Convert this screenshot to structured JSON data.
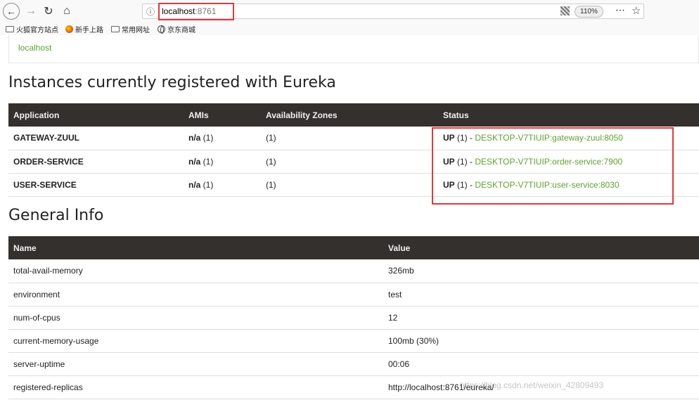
{
  "browser": {
    "url_host": "localhost",
    "url_port": ":8761",
    "zoom": "110%"
  },
  "bookmarks": [
    {
      "label": "火狐官方站点",
      "icon": "folder-icon"
    },
    {
      "label": "新手上路",
      "icon": "firefox-icon"
    },
    {
      "label": "常用网址",
      "icon": "folder-icon"
    },
    {
      "label": "京东商城",
      "icon": "globe-icon"
    }
  ],
  "page": {
    "hostname": "localhost",
    "instances_heading": "Instances currently registered with Eureka",
    "general_heading": "General Info"
  },
  "instances": {
    "headers": [
      "Application",
      "AMIs",
      "Availability Zones",
      "Status"
    ],
    "rows": [
      {
        "app": "GATEWAY-ZUUL",
        "ami_bold": "n/a",
        "ami_count": " (1)",
        "zones": "(1)",
        "status": "UP",
        "status_count": " (1) - ",
        "instance": "DESKTOP-V7TIUIP:gateway-zuul:8050"
      },
      {
        "app": "ORDER-SERVICE",
        "ami_bold": "n/a",
        "ami_count": " (1)",
        "zones": "(1)",
        "status": "UP",
        "status_count": " (1) - ",
        "instance": "DESKTOP-V7TIUIP:order-service:7900"
      },
      {
        "app": "USER-SERVICE",
        "ami_bold": "n/a",
        "ami_count": " (1)",
        "zones": "(1)",
        "status": "UP",
        "status_count": " (1) - ",
        "instance": "DESKTOP-V7TIUIP:user-service:8030"
      }
    ]
  },
  "general_info": {
    "headers": [
      "Name",
      "Value"
    ],
    "rows": [
      {
        "name": "total-avail-memory",
        "value": "326mb"
      },
      {
        "name": "environment",
        "value": "test"
      },
      {
        "name": "num-of-cpus",
        "value": "12"
      },
      {
        "name": "current-memory-usage",
        "value": "100mb (30%)"
      },
      {
        "name": "server-uptime",
        "value": "00:06"
      },
      {
        "name": "registered-replicas",
        "value": "http://localhost:8761/eureka/"
      }
    ]
  },
  "watermark": "https://blog.csdn.net/weixin_42809493",
  "colors": {
    "link_green": "#5fa134",
    "header_bg": "#34302d",
    "highlight_red": "#e0393e"
  }
}
